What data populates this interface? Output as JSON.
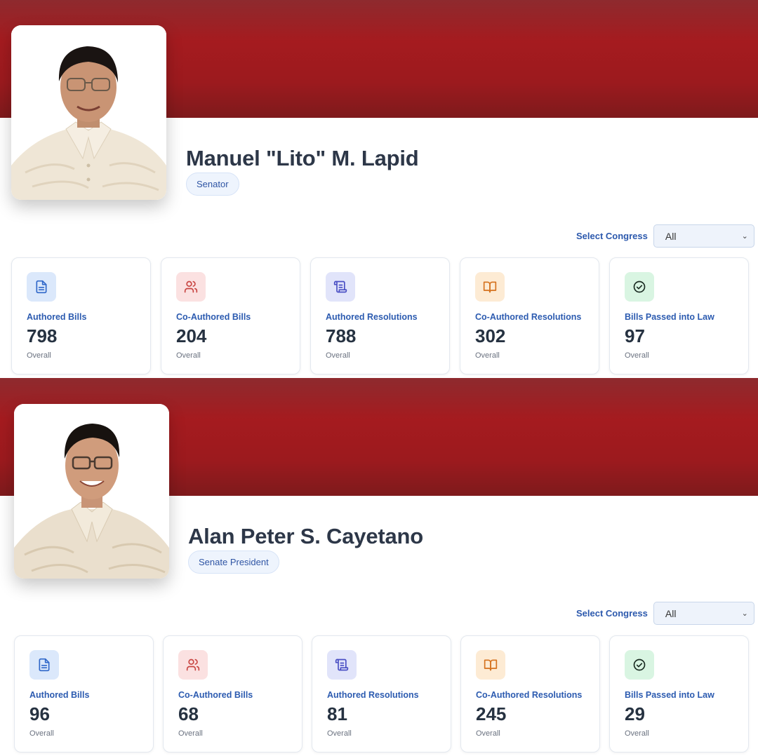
{
  "colors": {
    "banner": "#a51b1f",
    "accent_text": "#2c59ad",
    "icon_blue": "#2f67c9",
    "icon_red": "#c84542",
    "icon_indigo": "#4a4fc4",
    "icon_orange": "#d5721e",
    "icon_green": "#1f7a43"
  },
  "profiles": [
    {
      "photo": "senator-portrait",
      "name": "Manuel \"Lito\" M. Lapid",
      "position": "Senator",
      "filter": {
        "label": "Select Congress",
        "selected": "All"
      },
      "stats": [
        {
          "icon": "document-icon",
          "label": "Authored Bills",
          "value": "798",
          "sub": "Overall"
        },
        {
          "icon": "users-icon",
          "label": "Co-Authored Bills",
          "value": "204",
          "sub": "Overall"
        },
        {
          "icon": "scroll-icon",
          "label": "Authored Resolutions",
          "value": "788",
          "sub": "Overall"
        },
        {
          "icon": "book-open-icon",
          "label": "Co-Authored Resolutions",
          "value": "302",
          "sub": "Overall"
        },
        {
          "icon": "check-circle-icon",
          "label": "Bills Passed into Law",
          "value": "97",
          "sub": "Overall"
        }
      ]
    },
    {
      "photo": "senate-president-portrait",
      "name": "Alan Peter S. Cayetano",
      "position": "Senate President",
      "filter": {
        "label": "Select Congress",
        "selected": "All"
      },
      "stats": [
        {
          "icon": "document-icon",
          "label": "Authored Bills",
          "value": "96",
          "sub": "Overall"
        },
        {
          "icon": "users-icon",
          "label": "Co-Authored Bills",
          "value": "68",
          "sub": "Overall"
        },
        {
          "icon": "scroll-icon",
          "label": "Authored Resolutions",
          "value": "81",
          "sub": "Overall"
        },
        {
          "icon": "book-open-icon",
          "label": "Co-Authored Resolutions",
          "value": "245",
          "sub": "Overall"
        },
        {
          "icon": "check-circle-icon",
          "label": "Bills Passed into Law",
          "value": "29",
          "sub": "Overall"
        }
      ]
    }
  ]
}
